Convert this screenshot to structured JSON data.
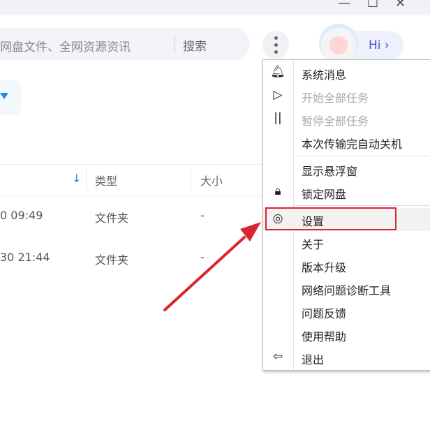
{
  "window": {
    "minimize": "—",
    "maximize": "☐",
    "close": "✕"
  },
  "search": {
    "placeholder": "网盘文件、全网资源资讯",
    "button": "搜索"
  },
  "greeting": "Hi ›",
  "table": {
    "headers": [
      "类型",
      "大小"
    ],
    "sort_icon": "↓",
    "rows": [
      {
        "date": "0 09:49",
        "type": "文件夹",
        "size": "-"
      },
      {
        "date": "30 21:44",
        "type": "文件夹",
        "size": "-"
      }
    ]
  },
  "menu": {
    "items": [
      {
        "label": "系统消息",
        "icon": "bell-icon",
        "disabled": false
      },
      {
        "label": "开始全部任务",
        "icon": "play-icon",
        "disabled": true
      },
      {
        "label": "暂停全部任务",
        "icon": "pause-icon",
        "disabled": true
      },
      {
        "label": "本次传输完自动关机",
        "icon": "",
        "disabled": false
      },
      {
        "label": "显示悬浮窗",
        "icon": "",
        "disabled": false
      },
      {
        "label": "锁定网盘",
        "icon": "lock-icon",
        "disabled": false
      },
      {
        "label": "设置",
        "icon": "settings-icon",
        "disabled": false,
        "highlighted": true
      },
      {
        "label": "关于",
        "icon": "",
        "disabled": false
      },
      {
        "label": "版本升级",
        "icon": "",
        "disabled": false
      },
      {
        "label": "网络问题诊断工具",
        "icon": "",
        "disabled": false
      },
      {
        "label": "问题反馈",
        "icon": "",
        "disabled": false
      },
      {
        "label": "使用帮助",
        "icon": "",
        "disabled": false
      },
      {
        "label": "退出",
        "icon": "logout-icon",
        "disabled": false
      }
    ]
  },
  "colors": {
    "annotation": "#d9262c",
    "accent": "#1e88e5"
  }
}
